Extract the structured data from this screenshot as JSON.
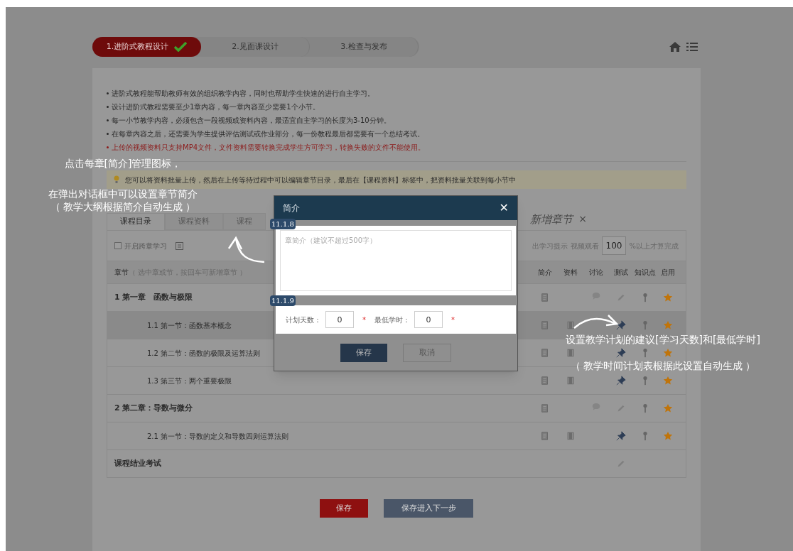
{
  "steps": [
    {
      "label": "1.进阶式教程设计",
      "selected": true,
      "done": true
    },
    {
      "label": "2.见面课设计",
      "selected": false,
      "done": false
    },
    {
      "label": "3.检查与发布",
      "selected": false,
      "done": false
    }
  ],
  "notes": [
    {
      "text": "进阶式教程能帮助教师有效的组织教学内容，同时也帮助学生快速的进行自主学习。",
      "kind": "normal"
    },
    {
      "text": "设计进阶式教程需要至少1章内容，每一章内容至少需要1个小节。",
      "kind": "normal"
    },
    {
      "text": "每一小节教学内容，必须包含一段视频或资料内容，最适宜自主学习的长度为3-10分钟。",
      "kind": "normal"
    },
    {
      "text": "在每章内容之后，还需要为学生提供评估测试或作业部分，每一份教程最后都需要有一个总结考试。",
      "kind": "normal"
    },
    {
      "text": "上传的视频资料只支持MP4文件，文件资料需要转换完成学生方可学习，转换失败的文件不能使用。",
      "kind": "warning"
    }
  ],
  "tip": "您可以将资料批量上传，然后在上传等待过程中可以编辑章节目录，最后在【课程资料】标签中，把资料批量关联到每小节中",
  "tabs": [
    {
      "label": "课程目录",
      "selected": true
    },
    {
      "label": "课程资料",
      "selected": false
    },
    {
      "label": "课程",
      "selected": false
    }
  ],
  "add_chapter": "新增章节",
  "add_chapter_close": "×",
  "toolbar": {
    "cross_chapter": {
      "label": "开启跨章学习",
      "checked": false
    },
    "prompt_label": "出学习提示",
    "watch_label": "视频观看",
    "watch_value": "100",
    "watch_suffix": "%以上才算完成"
  },
  "table": {
    "first_column": "章节",
    "first_column_hint": "（ 选中章或节，按回车可新增章节 ）",
    "columns": [
      "简介",
      "资料",
      "讨论",
      "测试",
      "知识点",
      "启用"
    ],
    "rows": [
      {
        "label": "1 第一章　函数与极限",
        "kind": "chapter",
        "selected": false,
        "cells": [
          {
            "kind": "doc"
          },
          {
            "kind": "empty"
          },
          {
            "kind": "chat"
          },
          {
            "kind": "pencil"
          },
          {
            "kind": "key"
          },
          {
            "kind": "star"
          }
        ]
      },
      {
        "label": "1.1 第一节：函数基本概念",
        "kind": "section",
        "selected": true,
        "cells": [
          {
            "kind": "doc"
          },
          {
            "kind": "film"
          },
          {
            "kind": "empty"
          },
          {
            "kind": "pin"
          },
          {
            "kind": "key"
          },
          {
            "kind": "star"
          }
        ]
      },
      {
        "label": "1.2 第二节：函数的极限及运算法则",
        "kind": "section",
        "selected": false,
        "cells": [
          {
            "kind": "doc"
          },
          {
            "kind": "film"
          },
          {
            "kind": "empty"
          },
          {
            "kind": "pin"
          },
          {
            "kind": "key"
          },
          {
            "kind": "star"
          }
        ]
      },
      {
        "label": "1.3 第三节：两个重要极限",
        "kind": "section",
        "selected": false,
        "cells": [
          {
            "kind": "doc"
          },
          {
            "kind": "film"
          },
          {
            "kind": "empty"
          },
          {
            "kind": "pin"
          },
          {
            "kind": "key"
          },
          {
            "kind": "star"
          }
        ]
      },
      {
        "label": "2 第二章：导数与微分",
        "kind": "chapter",
        "selected": false,
        "cells": [
          {
            "kind": "doc"
          },
          {
            "kind": "empty"
          },
          {
            "kind": "chat"
          },
          {
            "kind": "pencil"
          },
          {
            "kind": "key"
          },
          {
            "kind": "star"
          }
        ]
      },
      {
        "label": "2.1 第一节：导数的定义和导数四则运算法则",
        "kind": "section",
        "selected": false,
        "cells": [
          {
            "kind": "doc"
          },
          {
            "kind": "film"
          },
          {
            "kind": "empty"
          },
          {
            "kind": "pin"
          },
          {
            "kind": "key"
          },
          {
            "kind": "star"
          }
        ]
      },
      {
        "label": "课程结业考试",
        "kind": "chapter",
        "selected": false,
        "cells": [
          {
            "kind": "empty"
          },
          {
            "kind": "empty"
          },
          {
            "kind": "empty"
          },
          {
            "kind": "pencil"
          },
          {
            "kind": "empty"
          },
          {
            "kind": "empty"
          }
        ]
      }
    ]
  },
  "buttons": [
    {
      "label": "保存",
      "kind": "primary"
    },
    {
      "label": "保存进入下一步",
      "kind": "secondary"
    }
  ],
  "dialog": {
    "title": "简介",
    "close": "✕",
    "intro_tag": "11.1.8",
    "intro_placeholder": "章简介（建议不超过500字）",
    "plan_tag": "11.1.9",
    "days_label": "计划天数：",
    "days_value": "0",
    "hours_label": "最低学时：",
    "hours_value": "0",
    "required_mark": "*",
    "save": "保存",
    "cancel": "取消"
  },
  "annotations": [
    {
      "lines": [
        "点击每章[简介]管理图标，",
        "在弹出对话框中可以设置章节简介",
        "（ 教学大纲根据简介自动生成 ）"
      ]
    },
    {
      "lines": [
        "设置教学计划的建议[学习天数]和[最低学时]",
        "（ 教学时间计划表根据此设置自动生成 ）"
      ]
    }
  ]
}
